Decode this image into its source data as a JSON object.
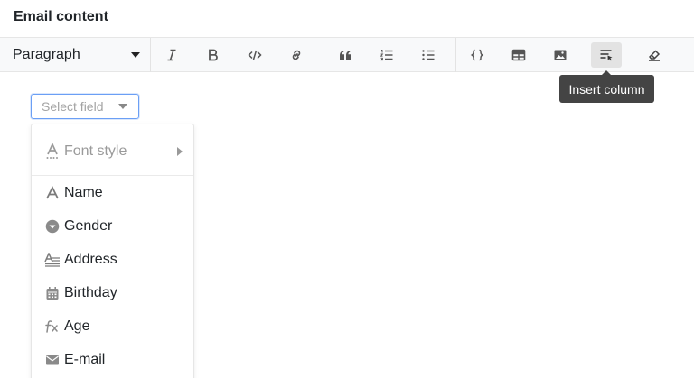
{
  "header": {
    "title": "Email content"
  },
  "toolbar": {
    "paragraph_label": "Paragraph",
    "buttons": [
      {
        "icon": "italic-icon"
      },
      {
        "icon": "bold-icon"
      },
      {
        "icon": "code-icon"
      },
      {
        "icon": "link-icon"
      },
      {
        "icon": "quote-icon"
      },
      {
        "icon": "ordered-list-icon"
      },
      {
        "icon": "unordered-list-icon"
      },
      {
        "icon": "code-block-icon"
      },
      {
        "icon": "table-icon"
      },
      {
        "icon": "image-icon"
      },
      {
        "icon": "insert-column-icon",
        "active": true
      },
      {
        "icon": "eraser-icon"
      }
    ]
  },
  "tooltip": {
    "text": "Insert column"
  },
  "field_select": {
    "placeholder": "Select field"
  },
  "dropdown": {
    "submenu": {
      "label": "Font style",
      "icon": "font-style-icon"
    },
    "items": [
      {
        "label": "Name",
        "icon": "text-icon"
      },
      {
        "label": "Gender",
        "icon": "single-select-icon"
      },
      {
        "label": "Address",
        "icon": "long-text-icon"
      },
      {
        "label": "Birthday",
        "icon": "calendar-icon"
      },
      {
        "label": "Age",
        "icon": "formula-icon"
      },
      {
        "label": "E-mail",
        "icon": "email-icon"
      }
    ]
  },
  "colors": {
    "toolbar_bg": "#f8f9fa",
    "active_button_bg": "#e3e3e3",
    "tooltip_bg": "#444444",
    "select_border": "#6b9ff5",
    "icon_gray": "#555555",
    "muted_icon": "#9a9a9a"
  }
}
